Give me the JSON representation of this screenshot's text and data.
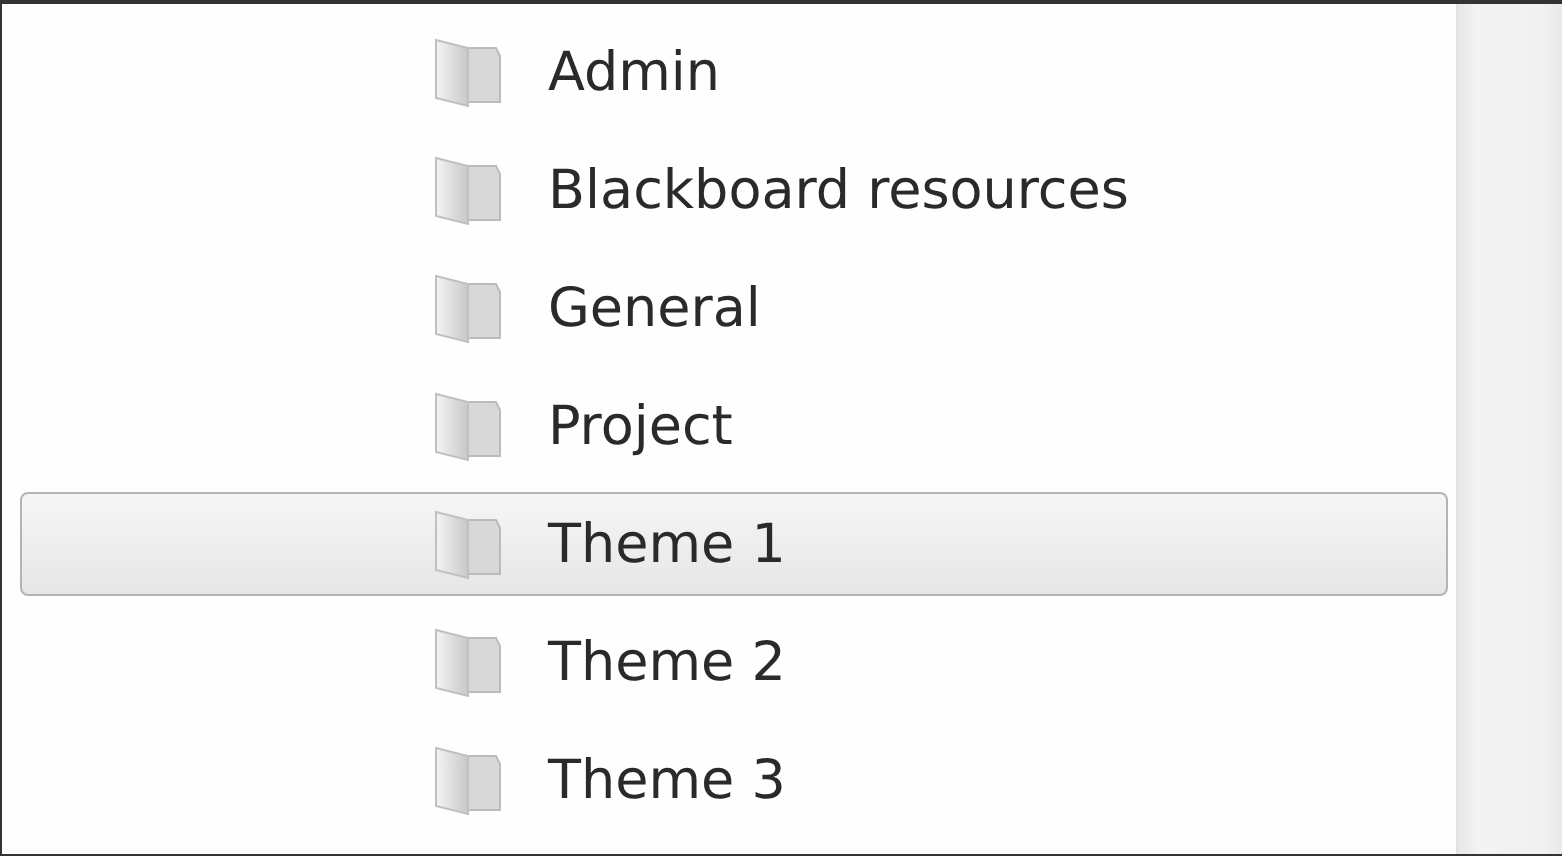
{
  "folders": [
    {
      "name": "Admin",
      "selected": false
    },
    {
      "name": "Blackboard resources",
      "selected": false
    },
    {
      "name": "General",
      "selected": false
    },
    {
      "name": "Project",
      "selected": false
    },
    {
      "name": "Theme 1",
      "selected": true
    },
    {
      "name": "Theme 2",
      "selected": false
    },
    {
      "name": "Theme 3",
      "selected": false
    }
  ]
}
